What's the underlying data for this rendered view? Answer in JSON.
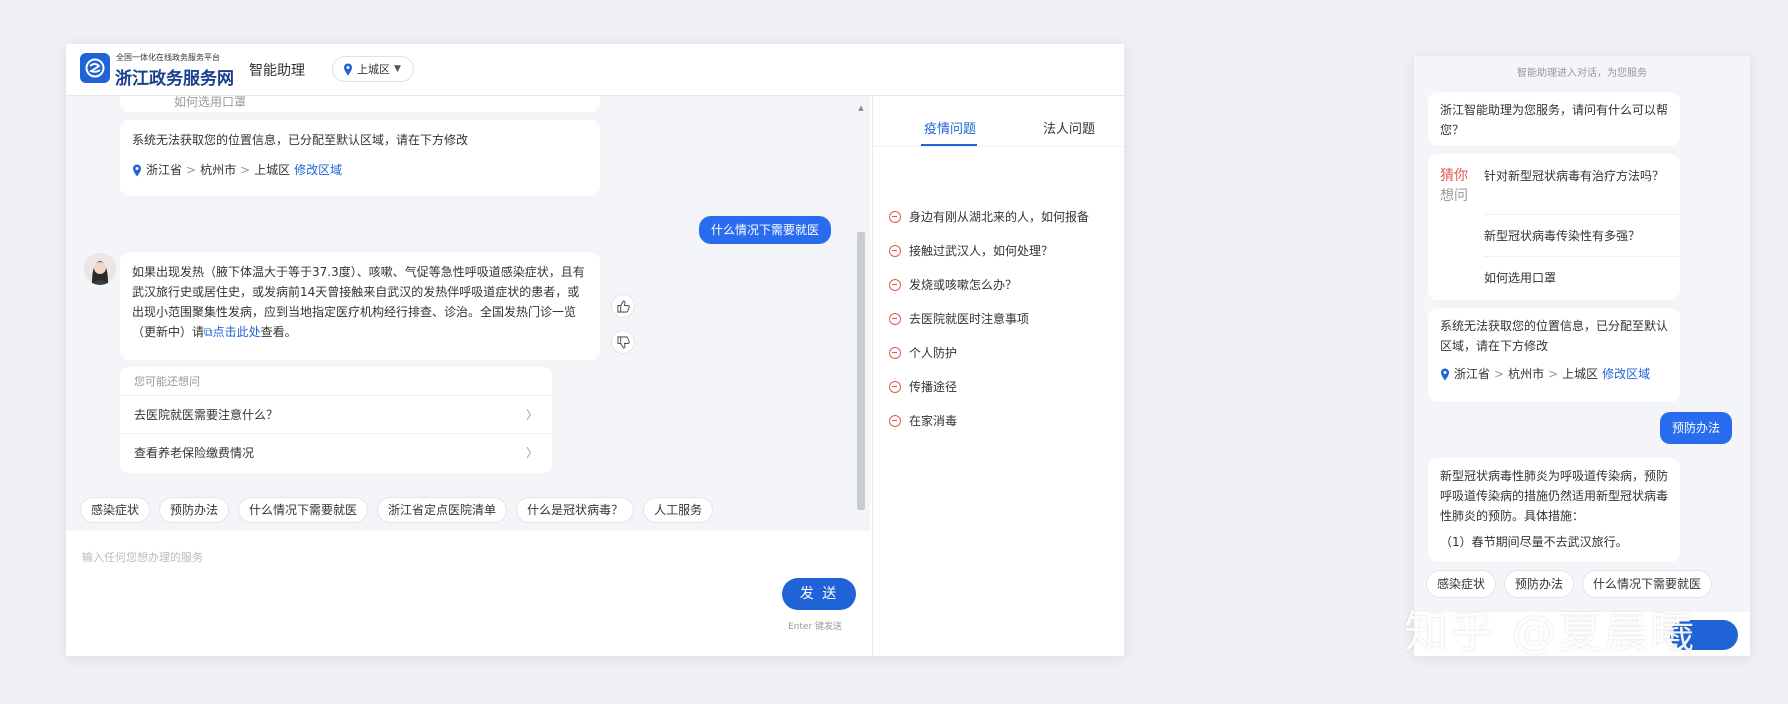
{
  "desktop": {
    "header": {
      "subtitle": "全国一体化在线政务服务平台",
      "title": "浙江政务服务网",
      "assistant": "智能助理",
      "region": "上城区"
    },
    "chat": {
      "clipped_text": "如何选用口罩",
      "location_msg": "系统无法获取您的位置信息，已分配至默认区域，请在下方修改",
      "location": {
        "province": "浙江省",
        "city": "杭州市",
        "district": "上城区",
        "modify": "修改区域",
        "sep": ">"
      },
      "user_msg": "什么情况下需要就医",
      "answer_text": "如果出现发热（腋下体温大于等于37.3度）、咳嗽、气促等急性呼吸道感染症状，且有武汉旅行史或居住史，或发病前14天曾接触来自武汉的发热伴呼吸道症状的患者，或出现小范围聚集性发病，应到当地指定医疗机构经行排查、诊治。全国发热门诊一览（更新中）请",
      "answer_link": "点击此处",
      "answer_tail": "查看。",
      "suggest_title": "您可能还想问",
      "suggestions": [
        "去医院就医需要注意什么？",
        "查看养老保险缴费情况"
      ]
    },
    "chips": [
      "感染症状",
      "预防办法",
      "什么情况下需要就医",
      "浙江省定点医院清单",
      "什么是冠状病毒？",
      "人工服务"
    ],
    "input": {
      "placeholder": "输入任何您想办理的服务",
      "send": "发 送",
      "hint": "Enter 键发送"
    },
    "panel": {
      "tabs": [
        "疫情问题",
        "法人问题"
      ],
      "faq": [
        "身边有刚从湖北来的人，如何报备",
        "接触过武汉人，如何处理？",
        "发烧或咳嗽怎么办？",
        "去医院就医时注意事项",
        "个人防护",
        "传播途径",
        "在家消毒"
      ]
    }
  },
  "mobile": {
    "top_note": "智能助理进入对话，为您服务",
    "greeting": "浙江智能助理为您服务，请问有什么可以帮您？",
    "guess_label_1": "猜你",
    "guess_label_2": "想问",
    "guess_questions": [
      "针对新型冠状病毒有治疗方法吗？",
      "新型冠状病毒传染性有多强？",
      "如何选用口罩"
    ],
    "location_msg": "系统无法获取您的位置信息，已分配至默认区域，请在下方修改",
    "location": {
      "province": "浙江省",
      "city": "杭州市",
      "district": "上城区",
      "modify": "修改区域",
      "sep": ">"
    },
    "user_msg": "预防办法",
    "answer_text": "新型冠状病毒性肺炎为呼吸道传染病，预防呼吸道传染病的措施仍然适用新型冠状病毒性肺炎的预防。具体措施：",
    "answer_item": "（1）春节期间尽量不去武汉旅行。",
    "chips": [
      "感染症状",
      "预防办法",
      "什么情况下需要就医"
    ]
  },
  "watermark": "知乎 @夏晨曦",
  "colors": {
    "accent": "#1f63d6",
    "user_bubble": "#2a6cf0",
    "faq_dot": "#e05a4e"
  }
}
